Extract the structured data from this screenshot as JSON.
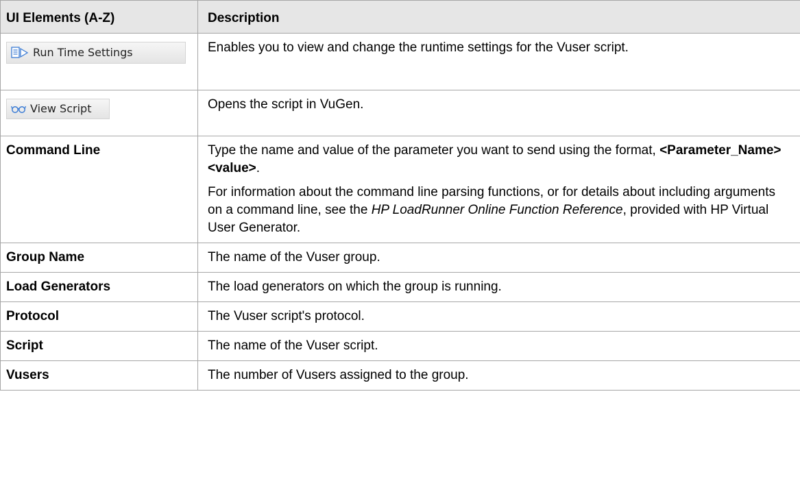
{
  "table": {
    "headers": [
      "UI Elements (A-Z)",
      "Description"
    ],
    "rows": [
      {
        "element": "Run Time Settings",
        "element_kind": "button-image",
        "icon": "run-time-settings-icon",
        "description": [
          "Enables you to view and change the runtime settings for the Vuser script."
        ]
      },
      {
        "element": "View Script",
        "element_kind": "button-image",
        "icon": "view-script-glasses-icon",
        "description": [
          "Opens the script in VuGen."
        ]
      },
      {
        "element": "Command Line",
        "element_kind": "text",
        "description": [
          {
            "before": "Type the name and value of the parameter you want to send using the format, ",
            "bold": "<Parameter_Name> <value>",
            "after": "."
          },
          {
            "before": "For information about the command line parsing functions, or for details about including arguments on a command line, see the ",
            "italic": "HP LoadRunner Online Function Reference",
            "after": ", provided with HP Virtual User Generator."
          }
        ]
      },
      {
        "element": "Group Name",
        "element_kind": "text",
        "description": [
          "The name of the Vuser group."
        ]
      },
      {
        "element": "Load Generators",
        "element_kind": "text",
        "description": [
          "The load generators on which the group is running."
        ]
      },
      {
        "element": "Protocol",
        "element_kind": "text",
        "description": [
          "The Vuser script's protocol."
        ]
      },
      {
        "element": "Script",
        "element_kind": "text",
        "description": [
          "The name of the Vuser script."
        ]
      },
      {
        "element": "Vusers",
        "element_kind": "text",
        "description": [
          "The number of Vusers assigned to the group."
        ]
      }
    ]
  },
  "colors": {
    "header_background": "#e6e6e6",
    "border": "#a6a6a6",
    "icon_blue": "#3a7bd5",
    "text": "#000000"
  }
}
